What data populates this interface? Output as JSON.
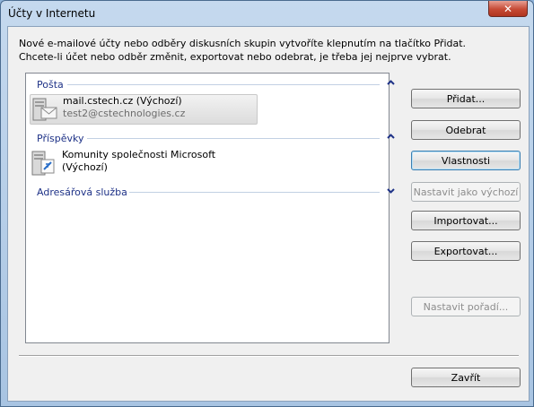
{
  "window": {
    "title": "Účty v Internetu",
    "close_glyph": "✕"
  },
  "intro": {
    "line1": "Nové e-mailové účty nebo odběry diskusních skupin vytvoříte klepnutím na tlačítko Přidat.",
    "line2": "Chcete-li účet nebo odběr změnit, exportovat nebo odebrat, je třeba jej nejprve vybrat."
  },
  "groups": {
    "mail": {
      "label": "Pošta",
      "chevron": "up"
    },
    "news": {
      "label": "Příspěvky",
      "chevron": "up"
    },
    "directory": {
      "label": "Adresářová služba",
      "chevron": "down"
    }
  },
  "accounts": {
    "mail": {
      "name": "mail.cstech.cz (Výchozí)",
      "email": "test2@cstechnologies.cz",
      "icon": "mail-server-icon"
    },
    "news": {
      "name_line1": "Komunity společnosti Microsoft",
      "name_line2": "(Výchozí)",
      "icon": "news-server-icon"
    }
  },
  "buttons": {
    "add": "Přidat...",
    "remove": "Odebrat",
    "properties": "Vlastnosti",
    "set_default": "Nastavit jako výchozí",
    "import": "Importovat...",
    "export": "Exportovat...",
    "set_order": "Nastavit pořadí...",
    "close": "Zavřít"
  }
}
